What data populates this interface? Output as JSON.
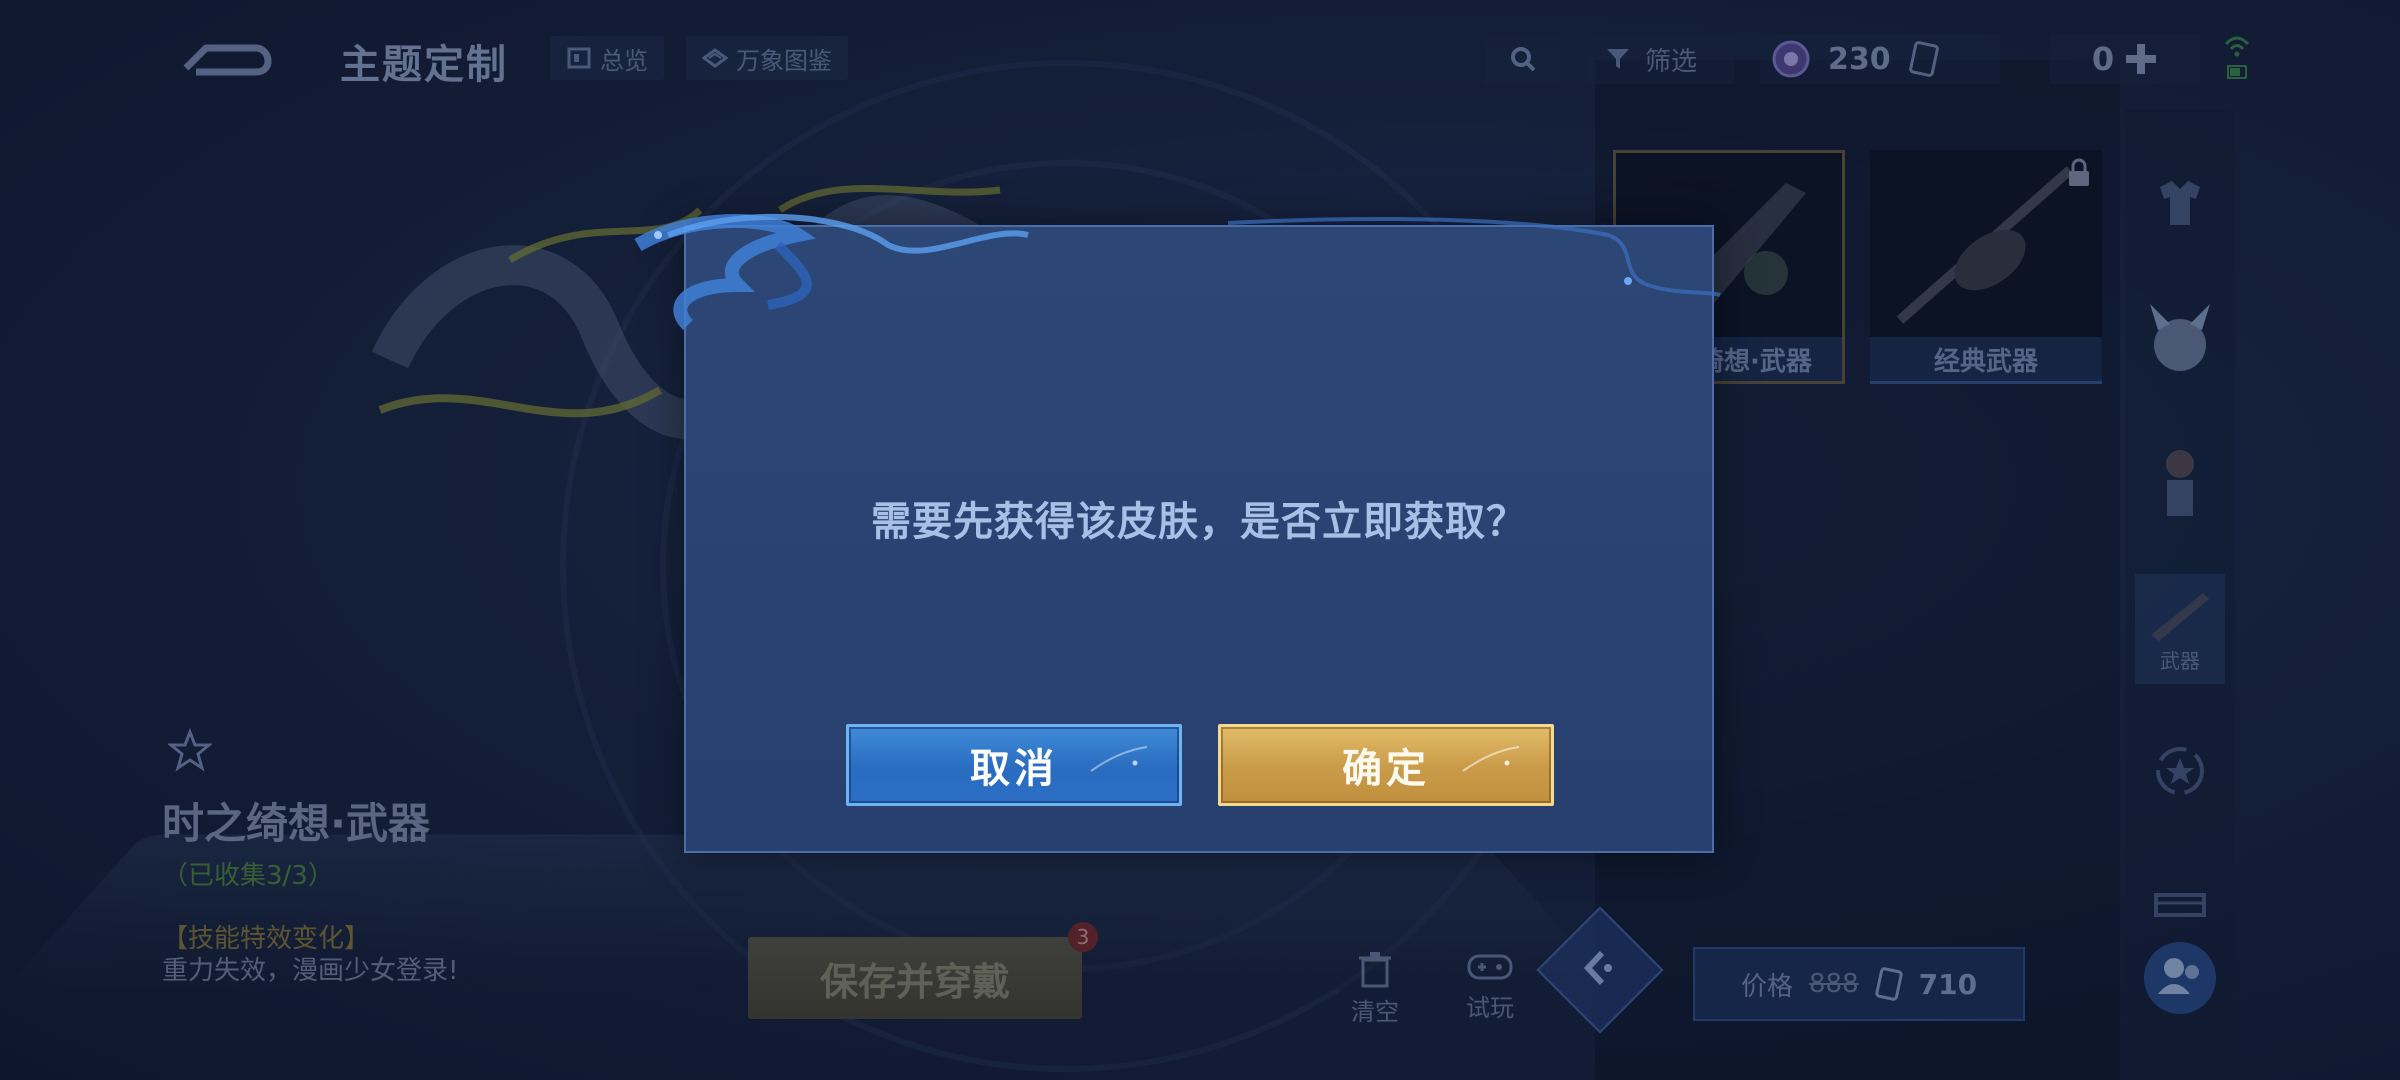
{
  "header": {
    "title": "主题定制",
    "chip_overview": "总览",
    "chip_gallery": "万象图鉴",
    "filter_label": "筛选",
    "currency_amount": "230",
    "coupon_amount": "0"
  },
  "items": [
    {
      "label": "时之绮想·武器"
    },
    {
      "label": "经典武器"
    }
  ],
  "side_rail": {
    "weapon_label": "武器"
  },
  "skin": {
    "name": "时之绮想·武器",
    "collected": "（已收集3/3）",
    "effect_title": "【技能特效变化】",
    "effect_desc": "重力失效，漫画少女登录!"
  },
  "actions": {
    "save_label": "保存并穿戴",
    "save_badge": "3",
    "clear_label": "清空",
    "try_label": "试玩"
  },
  "price": {
    "label": "价格",
    "original": "888",
    "current": "710"
  },
  "dialog": {
    "message": "需要先获得该皮肤，是否立即获取？",
    "cancel_label": "取消",
    "confirm_label": "确定"
  },
  "colors": {
    "dialog_bg": "#2c4676",
    "cancel_btn": "#2f75c8",
    "confirm_btn": "#d2a654",
    "background": "#1b2746"
  }
}
